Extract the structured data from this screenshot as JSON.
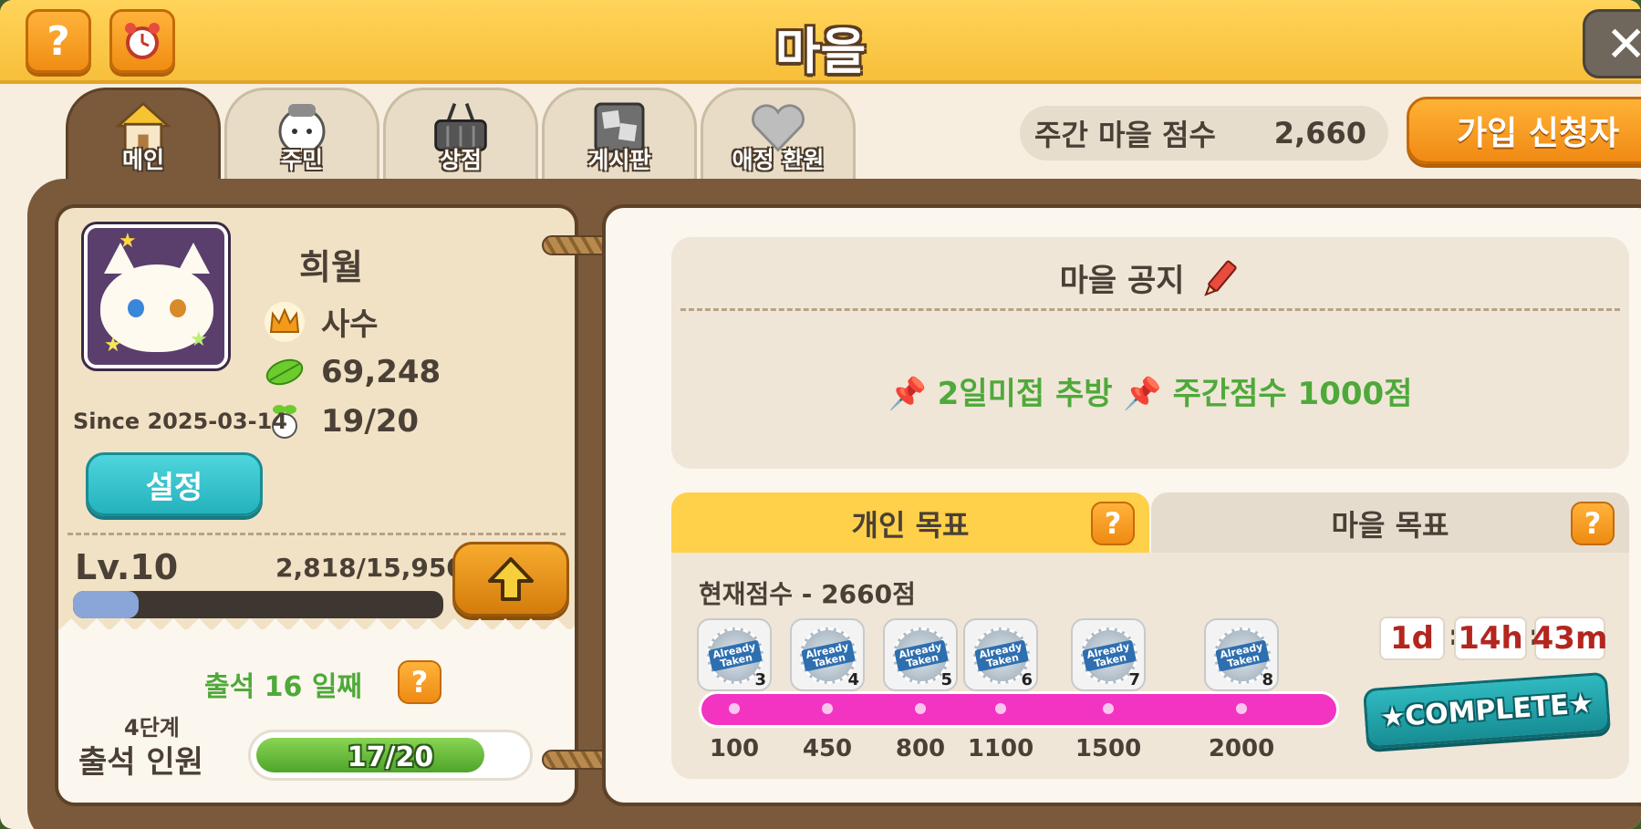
{
  "header": {
    "title": "마을",
    "help_label": "?",
    "close_label": "✕"
  },
  "tabs": [
    {
      "label": "메인",
      "active": true,
      "icon": "house-icon"
    },
    {
      "label": "주민",
      "active": false,
      "icon": "resident-icon"
    },
    {
      "label": "상점",
      "active": false,
      "icon": "basket-icon"
    },
    {
      "label": "게시판",
      "active": false,
      "icon": "board-icon"
    },
    {
      "label": "애정 환원",
      "active": false,
      "icon": "heart-icon"
    }
  ],
  "weekly_score": {
    "label": "주간 마을 점수",
    "value": "2,660"
  },
  "apply_button": "가입 신청자",
  "profile": {
    "name": "희월",
    "role": "사수",
    "leaves": "69,248",
    "members": "19/20",
    "since": "Since 2025-03-14",
    "settings_label": "설정",
    "level": "Lv.10",
    "exp": "2,818/15,950",
    "exp_fraction": 0.177
  },
  "attendance": {
    "days_text": "출석 16 일째",
    "stage": "4단계",
    "label": "출석 인원",
    "value": "17/20",
    "fraction": 0.85
  },
  "notice": {
    "title": "마을 공지",
    "body": "📌 2일미접 추방 📌 주간점수 1000점"
  },
  "goals": {
    "personal_tab": "개인 목표",
    "village_tab": "마을 목표",
    "current_score": "현재점수 - 2660점",
    "milestones": [
      {
        "score": "100",
        "reward_num": "3",
        "badge": "Already Taken"
      },
      {
        "score": "450",
        "reward_num": "4",
        "badge": "Already Taken"
      },
      {
        "score": "800",
        "reward_num": "5",
        "badge": "Already Taken"
      },
      {
        "score": "1100",
        "reward_num": "6",
        "badge": "Already Taken"
      },
      {
        "score": "1500",
        "reward_num": "7",
        "badge": "Already Taken"
      },
      {
        "score": "2000",
        "reward_num": "8",
        "badge": "Already Taken"
      }
    ],
    "timer": {
      "days": "1d",
      "hours": "14h",
      "minutes": "43m"
    },
    "complete_label": "★COMPLETE★"
  },
  "colors": {
    "header_yellow": "#f7bf3a",
    "board_brown": "#7a5a3b",
    "notice_green": "#4fa93a",
    "track_pink": "#f334c2",
    "settings_teal": "#24b2bd"
  }
}
